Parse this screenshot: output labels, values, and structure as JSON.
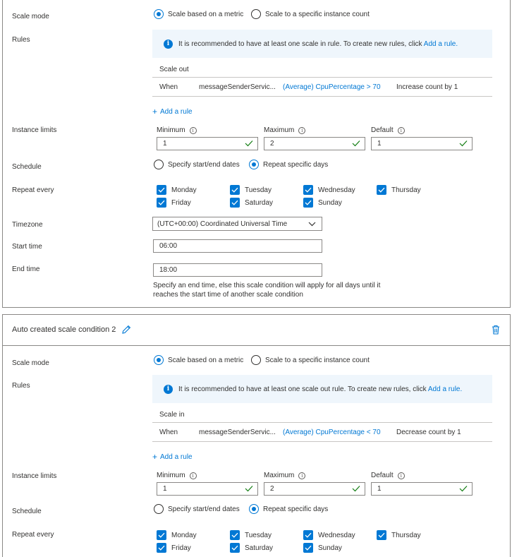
{
  "condition1": {
    "scale_mode_label": "Scale mode",
    "scale_mode_options": [
      "Scale based on a metric",
      "Scale to a specific instance count"
    ],
    "rules_label": "Rules",
    "info_text": "It is recommended to have at least one scale in rule. To create new rules, click ",
    "info_link": "Add a rule.",
    "rule_header": "Scale out",
    "rule": {
      "when": "When",
      "resource": "messageSenderServic...",
      "metric": "(Average) CpuPercentage > 70",
      "action": "Increase count by 1"
    },
    "add_rule": "Add a rule",
    "instance_limits_label": "Instance limits",
    "limits": {
      "minimum_label": "Minimum",
      "minimum": "1",
      "maximum_label": "Maximum",
      "maximum": "2",
      "default_label": "Default",
      "default": "1"
    },
    "schedule_label": "Schedule",
    "schedule_options": [
      "Specify start/end dates",
      "Repeat specific days"
    ],
    "repeat_label": "Repeat every",
    "days": [
      "Monday",
      "Tuesday",
      "Wednesday",
      "Thursday",
      "Friday",
      "Saturday",
      "Sunday"
    ],
    "timezone_label": "Timezone",
    "timezone": "(UTC+00:00) Coordinated Universal Time",
    "start_label": "Start time",
    "start_time": "06:00",
    "end_label": "End time",
    "end_time": "18:00",
    "end_note": "Specify an end time, else this scale condition will apply for all days until it reaches the start time of another scale condition"
  },
  "condition2": {
    "title": "Auto created scale condition 2",
    "scale_mode_label": "Scale mode",
    "scale_mode_options": [
      "Scale based on a metric",
      "Scale to a specific instance count"
    ],
    "rules_label": "Rules",
    "info_text": "It is recommended to have at least one scale out rule. To create new rules, click ",
    "info_link": "Add a rule.",
    "rule_header": "Scale in",
    "rule": {
      "when": "When",
      "resource": "messageSenderServic...",
      "metric": "(Average) CpuPercentage < 70",
      "action": "Decrease count by 1"
    },
    "add_rule": "Add a rule",
    "instance_limits_label": "Instance limits",
    "limits": {
      "minimum_label": "Minimum",
      "minimum": "1",
      "maximum_label": "Maximum",
      "maximum": "2",
      "default_label": "Default",
      "default": "1"
    },
    "schedule_label": "Schedule",
    "schedule_options": [
      "Specify start/end dates",
      "Repeat specific days"
    ],
    "repeat_label": "Repeat every",
    "days": [
      "Monday",
      "Tuesday",
      "Wednesday",
      "Thursday",
      "Friday",
      "Saturday",
      "Sunday"
    ]
  },
  "colors": {
    "accent": "#0078d4",
    "success": "#107c10",
    "border": "#8a8886"
  }
}
